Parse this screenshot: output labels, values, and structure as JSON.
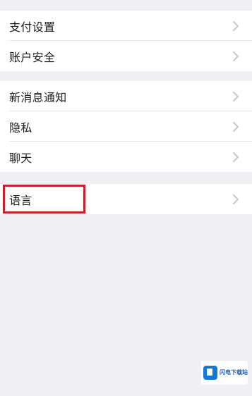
{
  "settings": {
    "group1": {
      "items": [
        {
          "label": "支付设置"
        },
        {
          "label": "账户安全"
        }
      ]
    },
    "group2": {
      "items": [
        {
          "label": "新消息通知"
        },
        {
          "label": "隐私"
        },
        {
          "label": "聊天"
        }
      ]
    },
    "group3": {
      "items": [
        {
          "label": "语言"
        }
      ]
    }
  },
  "icons": {
    "row_chevron": "chevron-right-icon",
    "watermark_logo": "site-logo-icon"
  },
  "colors": {
    "background": "#efeff4",
    "row_background": "#ffffff",
    "highlight_border": "#c2232f",
    "chevron": "#c7c7cc"
  },
  "watermark": {
    "title": "闪电下载站"
  }
}
